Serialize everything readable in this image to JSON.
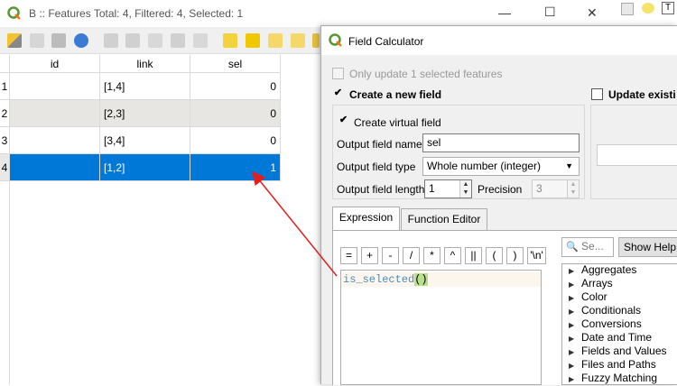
{
  "attr_window": {
    "title": "B :: Features Total: 4, Filtered: 4, Selected: 1",
    "controls": {
      "minimize": "—",
      "maximize": "☐",
      "close": "✕"
    }
  },
  "table": {
    "columns": [
      "id",
      "link",
      "sel"
    ],
    "rows": [
      {
        "num": "1",
        "id": "",
        "link": "[1,4]",
        "sel": "0"
      },
      {
        "num": "2",
        "id": "",
        "link": "[2,3]",
        "sel": "0"
      },
      {
        "num": "3",
        "id": "",
        "link": "[3,4]",
        "sel": "0"
      },
      {
        "num": "4",
        "id": "",
        "link": "[1,2]",
        "sel": "1"
      }
    ],
    "selected_row": 4
  },
  "calc": {
    "title": "Field Calculator",
    "only_selected_label": "Only update 1 selected features",
    "create_new_label": "Create a new field",
    "update_existing_label": "Update existi",
    "virtual_label": "Create virtual field",
    "name_label": "Output field name",
    "name_value": "sel",
    "type_label": "Output field type",
    "type_value": "Whole number (integer)",
    "length_label": "Output field length",
    "length_value": "1",
    "precision_label": "Precision",
    "precision_value": "3",
    "tabs": [
      "Expression",
      "Function Editor"
    ],
    "operators": [
      "=",
      "+",
      "-",
      "/",
      "*",
      "^",
      "||",
      "(",
      ")",
      "'\\n'"
    ],
    "expression_fn": "is_selected",
    "expression_paren": "()",
    "search_placeholder": "Se...",
    "show_help": "Show Help",
    "tree": [
      "Aggregates",
      "Arrays",
      "Color",
      "Conditionals",
      "Conversions",
      "Date and Time",
      "Fields and Values",
      "Files and Paths",
      "Fuzzy Matching"
    ]
  },
  "colors": {
    "selection": "#0078d7",
    "arrow": "#e02020",
    "qgis_green": "#589632"
  }
}
